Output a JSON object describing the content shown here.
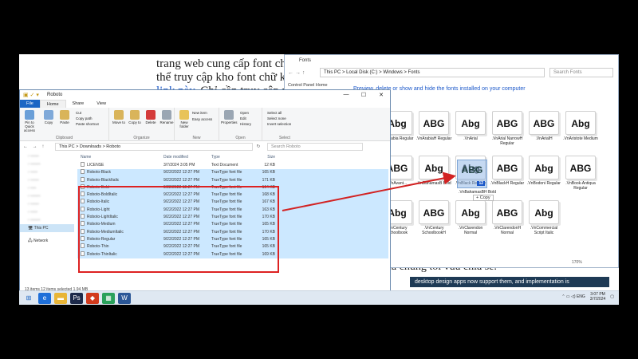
{
  "background_doc": {
    "line1": "trang web cung cấp font chữ",
    "line2": "thể truy cập kho font chữ kh",
    "line3_link": "link này",
    "line3_rest": ". Chỉ cần truy cập và",
    "bottom_text": "mà chúng tôi vừa chia sẻ.",
    "bottom_strip": "desktop design apps now support them, and implementation is"
  },
  "fonts_window": {
    "title": "Fonts",
    "path": "This PC  >  Local Disk (C:)  >  Windows  >  Fonts",
    "search_placeholder": "Search Fonts",
    "control_panel_home": "Control Panel Home",
    "info": "Preview, delete or show and hide the fonts installed on your computer",
    "zoom": "170%",
    "fonts": [
      {
        "glyph": "Abg",
        "label": ".VnArabia Regular"
      },
      {
        "glyph": "ABG",
        "label": ".VnArabiaH Regular"
      },
      {
        "glyph": "Abg",
        "label": ".VnArial"
      },
      {
        "glyph": "ABG",
        "label": ".VnArial NarrowH Regular"
      },
      {
        "glyph": "ABG",
        "label": ".VnArialH"
      },
      {
        "glyph": "Abg",
        "label": ".VnAristote Medium"
      },
      {
        "glyph": "ABG",
        "label": ".VnAvant..."
      },
      {
        "glyph": "Abg",
        "label": ".VnBahamasB Bold"
      },
      {
        "glyph": "Abg",
        "label": ".VnBlack Regular"
      },
      {
        "glyph": "ABG",
        "label": ".VnBlackH Regular"
      },
      {
        "glyph": "Abg",
        "label": ".VnBodoni Regular"
      },
      {
        "glyph": "ABG",
        "label": ".VnBook-Antiqua Regular"
      },
      {
        "glyph": "Abg",
        "label": ".VnCentury Schoolbook"
      },
      {
        "glyph": "ABG",
        "label": ".VnCentury SchoolbookH"
      },
      {
        "glyph": "Abg",
        "label": ".VnClarendon Normal"
      },
      {
        "glyph": "ABG",
        "label": ".VnClarendonH Normal"
      },
      {
        "glyph": "Abg",
        "label": ".VnCommercial Script Italic"
      }
    ],
    "drag_glyph": "ABG",
    "drag_count": "12",
    "drag_label": ".VnBahamasBH Bold",
    "copy_tooltip": "+ Copy"
  },
  "explorer": {
    "title": "Roboto",
    "tabs": [
      "File",
      "Home",
      "Share",
      "View"
    ],
    "ribbon": {
      "clipboard": {
        "label": "Clipboard",
        "pin": "Pin to Quick access",
        "copy": "Copy",
        "paste": "Paste",
        "cut": "Cut",
        "copy_path": "Copy path",
        "paste_shortcut": "Paste shortcut"
      },
      "organize": {
        "label": "Organize",
        "move_to": "Move to",
        "copy_to": "Copy to",
        "delete": "Delete",
        "rename": "Rename"
      },
      "new": {
        "label": "New",
        "new_folder": "New folder",
        "new_item": "New item",
        "easy_access": "Easy access"
      },
      "open": {
        "label": "Open",
        "properties": "Properties",
        "open": "Open",
        "edit": "Edit",
        "history": "History"
      },
      "select": {
        "label": "Select",
        "select_all": "Select all",
        "select_none": "Select none",
        "invert": "Invert selection"
      }
    },
    "path": "This PC  >  Downloads  >  Roboto",
    "search_placeholder": "Search Roboto",
    "nav": [
      "This PC",
      "Network"
    ],
    "columns": {
      "name": "Name",
      "date": "Date modified",
      "type": "Type",
      "size": "Size"
    },
    "files": [
      {
        "name": "LICENSE",
        "date": "3/7/2024 3:05 PM",
        "type": "Text Document",
        "size": "12 KB",
        "selected": false
      },
      {
        "name": "Roboto-Black",
        "date": "9/22/2022 12:27 PM",
        "type": "TrueType font file",
        "size": "165 KB",
        "selected": true
      },
      {
        "name": "Roboto-BlackItalic",
        "date": "9/22/2022 12:27 PM",
        "type": "TrueType font file",
        "size": "171 KB",
        "selected": true
      },
      {
        "name": "Roboto-Bold",
        "date": "9/22/2022 12:27 PM",
        "type": "TrueType font file",
        "size": "164 KB",
        "selected": true
      },
      {
        "name": "Roboto-BoldItalic",
        "date": "9/22/2022 12:27 PM",
        "type": "TrueType font file",
        "size": "168 KB",
        "selected": true
      },
      {
        "name": "Roboto-Italic",
        "date": "9/22/2022 12:27 PM",
        "type": "TrueType font file",
        "size": "167 KB",
        "selected": true
      },
      {
        "name": "Roboto-Light",
        "date": "9/22/2022 12:27 PM",
        "type": "TrueType font file",
        "size": "163 KB",
        "selected": true
      },
      {
        "name": "Roboto-LightItalic",
        "date": "9/22/2022 12:27 PM",
        "type": "TrueType font file",
        "size": "170 KB",
        "selected": true
      },
      {
        "name": "Roboto-Medium",
        "date": "9/22/2022 12:27 PM",
        "type": "TrueType font file",
        "size": "165 KB",
        "selected": true
      },
      {
        "name": "Roboto-MediumItalic",
        "date": "9/22/2022 12:27 PM",
        "type": "TrueType font file",
        "size": "170 KB",
        "selected": true
      },
      {
        "name": "Roboto-Regular",
        "date": "9/22/2022 12:27 PM",
        "type": "TrueType font file",
        "size": "165 KB",
        "selected": true
      },
      {
        "name": "Roboto-Thin",
        "date": "9/22/2022 12:27 PM",
        "type": "TrueType font file",
        "size": "165 KB",
        "selected": true
      },
      {
        "name": "Roboto-ThinItalic",
        "date": "9/22/2022 12:27 PM",
        "type": "TrueType font file",
        "size": "169 KB",
        "selected": true
      }
    ],
    "status": "13 items    12 items selected  1.94 MB"
  },
  "taskbar": {
    "lang": "ENG",
    "time": "3:07 PM",
    "date": "3/7/2024"
  },
  "colors": {
    "accent": "#1c66c4",
    "selection": "#cce8ff",
    "highlight_border": "#d22222"
  }
}
